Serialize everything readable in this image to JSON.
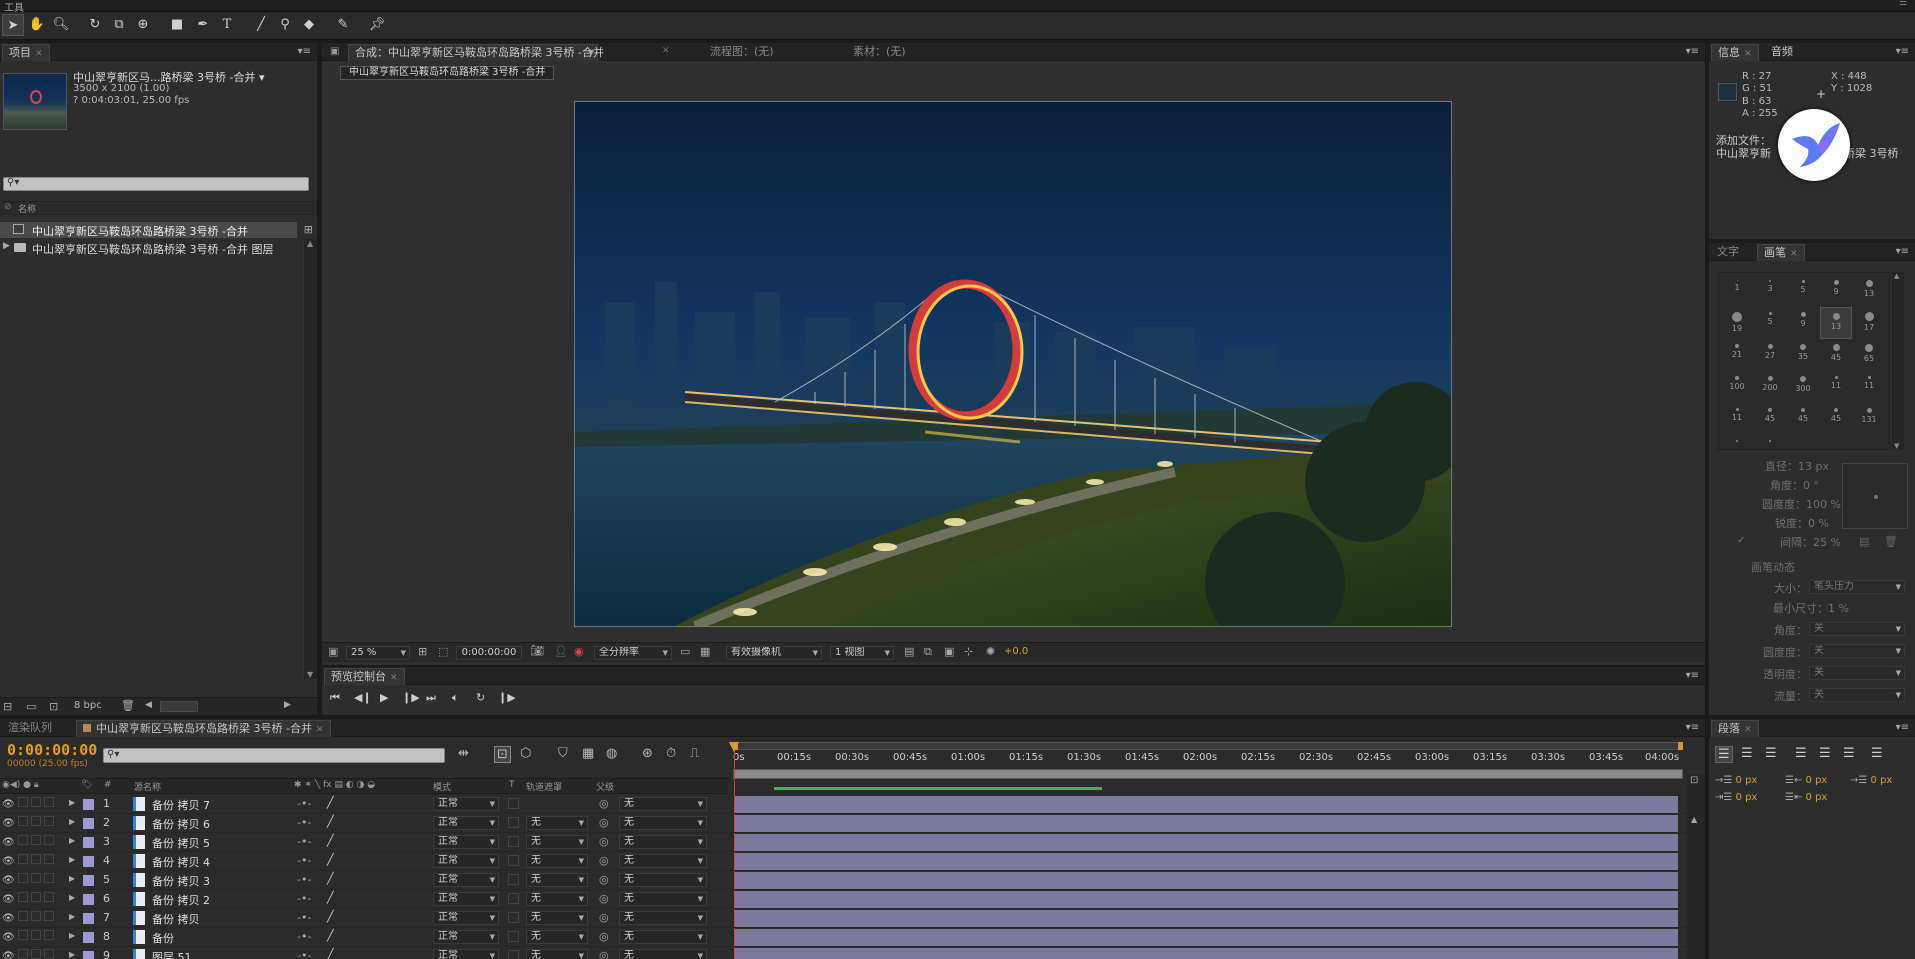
{
  "tools": {
    "label": "工具",
    "icons": [
      "select-tool-icon",
      "hand-tool-icon",
      "zoom-tool-icon",
      "rotate-tool-icon",
      "camera-orbit-tool-icon",
      "pan-behind-tool-icon",
      "rectangle-tool-icon",
      "pen-tool-icon",
      "text-tool-icon",
      "brush-tool-icon",
      "clone-stamp-tool-icon",
      "eraser-tool-icon",
      "roto-brush-tool-icon",
      "puppet-pin-tool-icon"
    ]
  },
  "project": {
    "tab": "项目",
    "item_name": "中山翠亨新区马...路桥梁 3号桥 -合并 ▾",
    "dims": "3500 x 2100 (1.00)",
    "duration": "? 0:04:03:01, 25.00 fps",
    "col_name": "名称",
    "items": [
      "中山翠亨新区马鞍岛环岛路桥梁 3号桥 -合并",
      "中山翠亨新区马鞍岛环岛路桥梁 3号桥 -合并 图层"
    ],
    "bpc": "8 bpc"
  },
  "viewer": {
    "comp_tab": "合成：中山翠亨新区马鞍岛环岛路桥梁 3号桥 -合并",
    "flow_tab": "流程图：(无)",
    "footage_tab": "素材：(无)",
    "comp_name": "中山翠亨新区马鞍岛环岛路桥梁 3号桥 -合并",
    "zoom": "25 %",
    "timecode": "0:00:00:00",
    "resolution": "全分辨率",
    "camera": "有效摄像机",
    "views": "1 视图",
    "exposure": "+0.0"
  },
  "preview": {
    "tab": "预览控制台"
  },
  "info": {
    "tab": "信息",
    "audio_tab": "音频",
    "r": "R : 27",
    "g": "G : 51",
    "b": "B : 63",
    "a": "A : 255",
    "x": "X : 448",
    "y": "Y : 1028",
    "add_file": "添加文件：",
    "file_name": "中山翠亨新",
    "file_suffix": "路桥梁 3号桥",
    "swatch": "#1b333f"
  },
  "brushes": {
    "text_tab": "文字",
    "brush_tab": "画笔",
    "sizes": [
      "1",
      "3",
      "5",
      "9",
      "13",
      "19",
      "5",
      "9",
      "13",
      "17",
      "21",
      "27",
      "35",
      "45",
      "65",
      "100",
      "200",
      "300",
      "11",
      "11",
      "11",
      "45",
      "45",
      "45",
      "131",
      "",
      ""
    ],
    "diameter": "直径：13 px",
    "angle": "角度：0 °",
    "roundness": "圆度度：100 %",
    "hardness": "锐度：0 %",
    "spacing": "间隔：25 %",
    "dynamics": "画笔动态",
    "size_lbl": "大小：",
    "size_val": "笔头压力",
    "min_size": "最小尺寸：1 %",
    "d_angle": "角度：",
    "d_round": "圆度度：",
    "d_opacity": "透明度：",
    "d_flow": "流量：",
    "none": "关"
  },
  "paragraph": {
    "tab": "段落",
    "v1": "0 px",
    "v2": "0 px",
    "v3": "0 px",
    "v4": "0 px",
    "v5": "0 px"
  },
  "timeline": {
    "render_tab": "渲染队列",
    "comp_tab": "中山翠亨新区马鞍岛环岛路桥梁 3号桥 -合并",
    "timecode": "0:00:00:00",
    "frames": "00000 (25.00 fps)",
    "col_num": "#",
    "col_source": "源名称",
    "col_mode": "模式",
    "col_t": "T",
    "col_trkmat": "轨道遮罩",
    "col_parent": "父级",
    "ticks": [
      "0s",
      "00:15s",
      "00:30s",
      "00:45s",
      "01:00s",
      "01:15s",
      "01:30s",
      "01:45s",
      "02:00s",
      "02:15s",
      "02:30s",
      "02:45s",
      "03:00s",
      "03:15s",
      "03:30s",
      "03:45s",
      "04:00s"
    ],
    "layers": [
      {
        "num": "1",
        "name": "备份 拷贝 7",
        "mode": "正常",
        "trk": "",
        "parent": "无"
      },
      {
        "num": "2",
        "name": "备份 拷贝 6",
        "mode": "正常",
        "trk": "无",
        "parent": "无"
      },
      {
        "num": "3",
        "name": "备份 拷贝 5",
        "mode": "正常",
        "trk": "无",
        "parent": "无"
      },
      {
        "num": "4",
        "name": "备份 拷贝 4",
        "mode": "正常",
        "trk": "无",
        "parent": "无"
      },
      {
        "num": "5",
        "name": "备份 拷贝 3",
        "mode": "正常",
        "trk": "无",
        "parent": "无"
      },
      {
        "num": "6",
        "name": "备份 拷贝 2",
        "mode": "正常",
        "trk": "无",
        "parent": "无"
      },
      {
        "num": "7",
        "name": "备份 拷贝",
        "mode": "正常",
        "trk": "无",
        "parent": "无"
      },
      {
        "num": "8",
        "name": "备份",
        "mode": "正常",
        "trk": "无",
        "parent": "无"
      },
      {
        "num": "9",
        "name": "图层 51",
        "mode": "正常",
        "trk": "无",
        "parent": "无"
      }
    ],
    "layer_color": "#9b9ad6",
    "bar_color": "#7b7a9f",
    "workarea_color": "#3bbd3b",
    "timecode_color": "#e0a020"
  }
}
